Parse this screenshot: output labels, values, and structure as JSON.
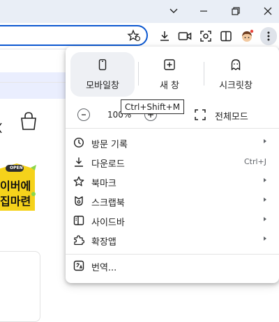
{
  "menu": {
    "top_buttons": [
      {
        "label": "모바일창",
        "icon": "mobile-icon"
      },
      {
        "label": "새 창",
        "icon": "new-window-icon"
      },
      {
        "label": "시크릿창",
        "icon": "incognito-icon"
      }
    ],
    "zoom": {
      "value": "100%",
      "minus_icon": "minus-icon",
      "plus_icon": "plus-icon",
      "fullscreen_label": "전체모드"
    },
    "tooltip": "Ctrl+Shift+M",
    "items": [
      {
        "label": "방문 기록",
        "icon": "history-icon",
        "shortcut": "",
        "submenu": true
      },
      {
        "label": "다운로드",
        "icon": "download-icon",
        "shortcut": "Ctrl+J",
        "submenu": false
      },
      {
        "label": "북마크",
        "icon": "star-icon",
        "shortcut": "",
        "submenu": true
      },
      {
        "label": "스크랩북",
        "icon": "scrapbook-icon",
        "shortcut": "",
        "submenu": true
      },
      {
        "label": "사이드바",
        "icon": "sidebar-icon",
        "shortcut": "",
        "submenu": true
      },
      {
        "label": "확장앱",
        "icon": "extension-icon",
        "shortcut": "",
        "submenu": true
      },
      {
        "label": "번역...",
        "icon": "translate-icon",
        "shortcut": "",
        "submenu": false
      }
    ]
  },
  "page": {
    "promo_badge": "OPEN",
    "promo_line1": "이버에",
    "promo_line2": "집마련"
  },
  "colors": {
    "accent": "#0b57d0",
    "titlebar": "#e9eef6",
    "banner": "#eaeefe"
  }
}
